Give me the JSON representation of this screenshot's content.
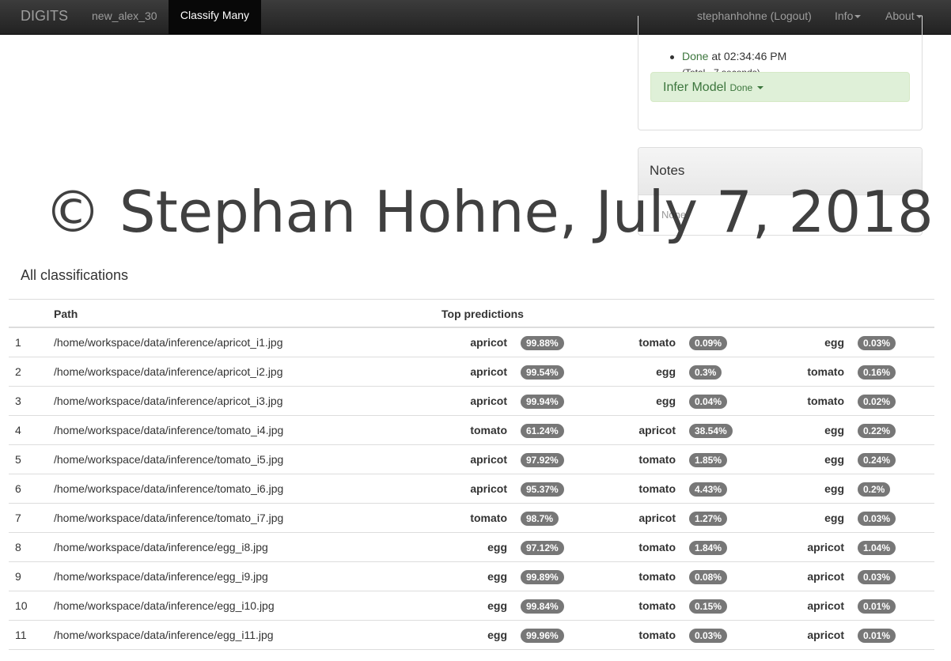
{
  "navbar": {
    "brand": "DIGITS",
    "model_link": "new_alex_30",
    "active_tab": "Classify Many",
    "user": "stephanhohne (Logout)",
    "info": "Info",
    "about": "About"
  },
  "job": {
    "done_label": "Done",
    "done_time": "at 02:34:46 PM",
    "total": "(Total - 7 seconds)",
    "infer_title": "Infer Model",
    "infer_status": "Done"
  },
  "notes": {
    "title": "Notes",
    "body": "None"
  },
  "watermark": "© Stephan Hohne, July 7, 2018",
  "classifications": {
    "title": "All classifications",
    "headers": {
      "path": "Path",
      "predictions": "Top predictions"
    },
    "rows": [
      {
        "n": "1",
        "path": "/home/workspace/data/inference/apricot_i1.jpg",
        "p": [
          [
            "apricot",
            "99.88%"
          ],
          [
            "tomato",
            "0.09%"
          ],
          [
            "egg",
            "0.03%"
          ]
        ]
      },
      {
        "n": "2",
        "path": "/home/workspace/data/inference/apricot_i2.jpg",
        "p": [
          [
            "apricot",
            "99.54%"
          ],
          [
            "egg",
            "0.3%"
          ],
          [
            "tomato",
            "0.16%"
          ]
        ]
      },
      {
        "n": "3",
        "path": "/home/workspace/data/inference/apricot_i3.jpg",
        "p": [
          [
            "apricot",
            "99.94%"
          ],
          [
            "egg",
            "0.04%"
          ],
          [
            "tomato",
            "0.02%"
          ]
        ]
      },
      {
        "n": "4",
        "path": "/home/workspace/data/inference/tomato_i4.jpg",
        "p": [
          [
            "tomato",
            "61.24%"
          ],
          [
            "apricot",
            "38.54%"
          ],
          [
            "egg",
            "0.22%"
          ]
        ]
      },
      {
        "n": "5",
        "path": "/home/workspace/data/inference/tomato_i5.jpg",
        "p": [
          [
            "apricot",
            "97.92%"
          ],
          [
            "tomato",
            "1.85%"
          ],
          [
            "egg",
            "0.24%"
          ]
        ]
      },
      {
        "n": "6",
        "path": "/home/workspace/data/inference/tomato_i6.jpg",
        "p": [
          [
            "apricot",
            "95.37%"
          ],
          [
            "tomato",
            "4.43%"
          ],
          [
            "egg",
            "0.2%"
          ]
        ]
      },
      {
        "n": "7",
        "path": "/home/workspace/data/inference/tomato_i7.jpg",
        "p": [
          [
            "tomato",
            "98.7%"
          ],
          [
            "apricot",
            "1.27%"
          ],
          [
            "egg",
            "0.03%"
          ]
        ]
      },
      {
        "n": "8",
        "path": "/home/workspace/data/inference/egg_i8.jpg",
        "p": [
          [
            "egg",
            "97.12%"
          ],
          [
            "tomato",
            "1.84%"
          ],
          [
            "apricot",
            "1.04%"
          ]
        ]
      },
      {
        "n": "9",
        "path": "/home/workspace/data/inference/egg_i9.jpg",
        "p": [
          [
            "egg",
            "99.89%"
          ],
          [
            "tomato",
            "0.08%"
          ],
          [
            "apricot",
            "0.03%"
          ]
        ]
      },
      {
        "n": "10",
        "path": "/home/workspace/data/inference/egg_i10.jpg",
        "p": [
          [
            "egg",
            "99.84%"
          ],
          [
            "tomato",
            "0.15%"
          ],
          [
            "apricot",
            "0.01%"
          ]
        ]
      },
      {
        "n": "11",
        "path": "/home/workspace/data/inference/egg_i11.jpg",
        "p": [
          [
            "egg",
            "99.96%"
          ],
          [
            "tomato",
            "0.03%"
          ],
          [
            "apricot",
            "0.01%"
          ]
        ]
      }
    ]
  }
}
